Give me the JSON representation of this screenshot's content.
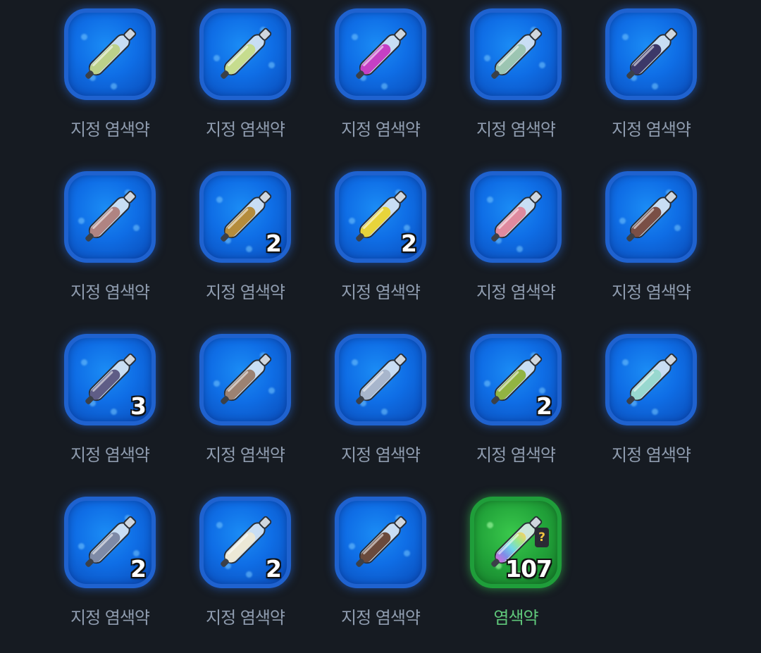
{
  "items": [
    {
      "label": "지정 염색약",
      "count": "",
      "color": "#bcd18a",
      "variant": "blue"
    },
    {
      "label": "지정 염색약",
      "count": "",
      "color": "#c6dc8e",
      "variant": "blue"
    },
    {
      "label": "지정 염색약",
      "count": "",
      "color": "#c540c4",
      "variant": "blue"
    },
    {
      "label": "지정 염색약",
      "count": "",
      "color": "#9cc5b2",
      "variant": "blue"
    },
    {
      "label": "지정 염색약",
      "count": "",
      "color": "#3c3868",
      "variant": "blue"
    },
    {
      "label": "지정 염색약",
      "count": "",
      "color": "#b08482",
      "variant": "blue"
    },
    {
      "label": "지정 염색약",
      "count": "2",
      "color": "#b48c3c",
      "variant": "blue"
    },
    {
      "label": "지정 염색약",
      "count": "2",
      "color": "#e8d43a",
      "variant": "blue"
    },
    {
      "label": "지정 염색약",
      "count": "",
      "color": "#e08a9e",
      "variant": "blue"
    },
    {
      "label": "지정 염색약",
      "count": "",
      "color": "#7a4f46",
      "variant": "blue"
    },
    {
      "label": "지정 염색약",
      "count": "3",
      "color": "#5f5d86",
      "variant": "blue"
    },
    {
      "label": "지정 염색약",
      "count": "",
      "color": "#9c8272",
      "variant": "blue"
    },
    {
      "label": "지정 염색약",
      "count": "",
      "color": "#a8b6cc",
      "variant": "blue"
    },
    {
      "label": "지정 염색약",
      "count": "2",
      "color": "#92b442",
      "variant": "blue"
    },
    {
      "label": "지정 염색약",
      "count": "",
      "color": "#98d8cf",
      "variant": "blue"
    },
    {
      "label": "지정 염색약",
      "count": "2",
      "color": "#7e8aa6",
      "variant": "blue"
    },
    {
      "label": "지정 염색약",
      "count": "2",
      "color": "#ece8d6",
      "variant": "blue"
    },
    {
      "label": "지정 염색약",
      "count": "",
      "color": "#6a4a3c",
      "variant": "blue"
    },
    {
      "label": "염색약",
      "count": "107",
      "color": "rainbow",
      "variant": "green",
      "tag": "?"
    }
  ]
}
